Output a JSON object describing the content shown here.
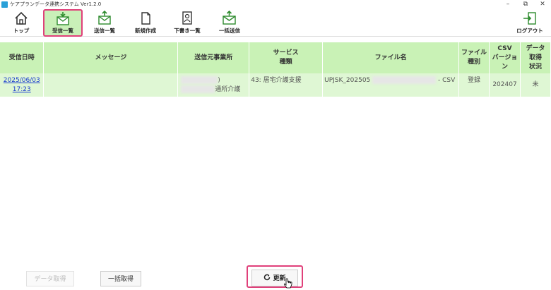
{
  "window": {
    "title": "ケアプランデータ連携システム Ver1.2.0",
    "min": "–",
    "restore": "⧉",
    "close": "✕"
  },
  "toolbar": {
    "top": "トップ",
    "inbox": "受信一覧",
    "sent": "送信一覧",
    "new": "新規作成",
    "drafts": "下書き一覧",
    "bulk_send": "一括送信",
    "logout": "ログアウト"
  },
  "table": {
    "headers": {
      "received": "受信日時",
      "message": "メッセージ",
      "sender": "送信元事業所",
      "service": [
        "サービス",
        "種類"
      ],
      "filename": "ファイル名",
      "filetype": [
        "ファイル",
        "種別"
      ],
      "csv": [
        "CSV",
        "バージョン"
      ],
      "status": [
        "データ",
        "取得",
        "状況"
      ]
    },
    "rows": [
      {
        "date": "2025/06/03",
        "time": "17:23",
        "message": "",
        "sender_1": ")",
        "sender_2": "通所介護",
        "service": "43: 居宅介護支援",
        "filename_prefix": "UPJSK_202505",
        "filename_suffix": "- CSV",
        "filetype": "登録",
        "csv_version": "202407",
        "status": "未"
      }
    ]
  },
  "buttons": {
    "data_fetch": "データ取得",
    "bulk_fetch": "一括取得",
    "refresh": "更新"
  },
  "colors": {
    "header": "#c9f2b6",
    "row": "#dff7d4",
    "highlight": "#e0407a"
  }
}
